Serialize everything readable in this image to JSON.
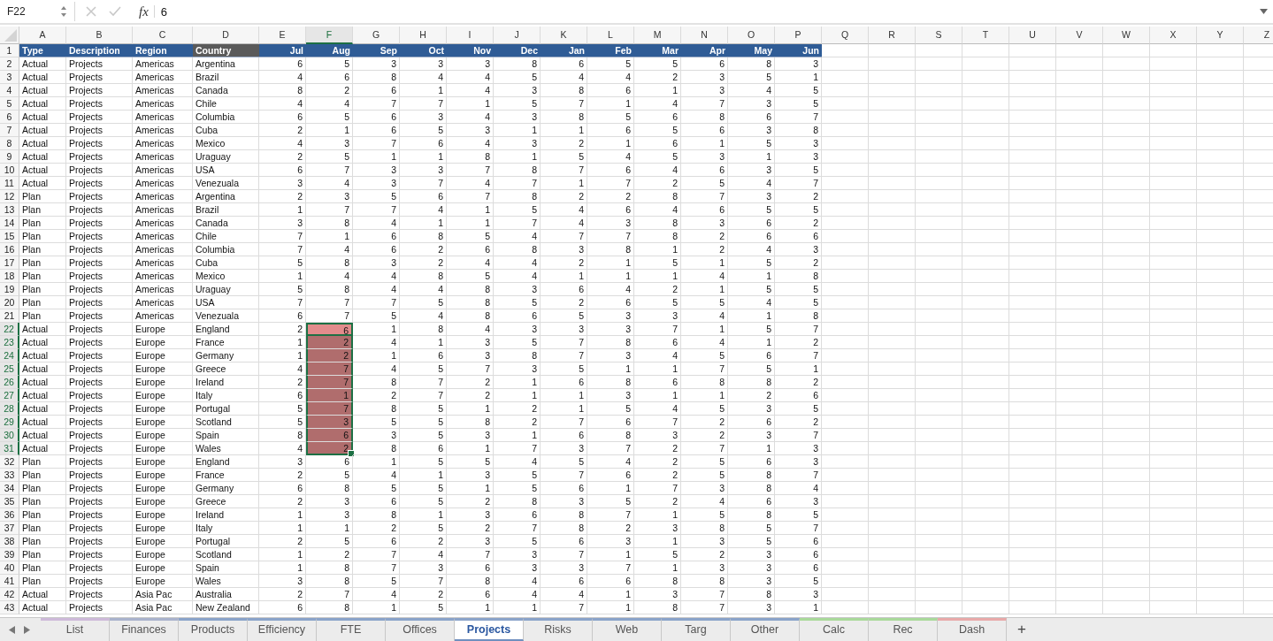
{
  "formula_bar": {
    "name_box": "F22",
    "function_label": "fx",
    "value": "6"
  },
  "columns": [
    {
      "letter": "A",
      "kind": "text",
      "selected": false
    },
    {
      "letter": "B",
      "kind": "text",
      "selected": false
    },
    {
      "letter": "C",
      "kind": "text",
      "selected": false
    },
    {
      "letter": "D",
      "kind": "text",
      "selected": false
    },
    {
      "letter": "E",
      "kind": "number",
      "selected": false
    },
    {
      "letter": "F",
      "kind": "number",
      "selected": true
    },
    {
      "letter": "G",
      "kind": "number",
      "selected": false
    },
    {
      "letter": "H",
      "kind": "number",
      "selected": false
    },
    {
      "letter": "I",
      "kind": "number",
      "selected": false
    },
    {
      "letter": "J",
      "kind": "number",
      "selected": false
    },
    {
      "letter": "K",
      "kind": "number",
      "selected": false
    },
    {
      "letter": "L",
      "kind": "number",
      "selected": false
    },
    {
      "letter": "M",
      "kind": "number",
      "selected": false
    },
    {
      "letter": "N",
      "kind": "number",
      "selected": false
    },
    {
      "letter": "O",
      "kind": "number",
      "selected": false
    },
    {
      "letter": "P",
      "kind": "number",
      "selected": false
    },
    {
      "letter": "Q",
      "selected": false
    },
    {
      "letter": "R",
      "selected": false
    },
    {
      "letter": "S",
      "selected": false
    },
    {
      "letter": "T",
      "selected": false
    },
    {
      "letter": "U",
      "selected": false
    },
    {
      "letter": "V",
      "selected": false
    },
    {
      "letter": "W",
      "selected": false
    },
    {
      "letter": "X",
      "selected": false
    },
    {
      "letter": "Y",
      "selected": false
    },
    {
      "letter": "Z",
      "selected": false
    }
  ],
  "header_row": {
    "number": "1",
    "cells": [
      {
        "text": "Type",
        "highlighted": false
      },
      {
        "text": "Description",
        "highlighted": false
      },
      {
        "text": "Region",
        "highlighted": false
      },
      {
        "text": "Country",
        "highlighted": true
      },
      {
        "text": "Jul",
        "highlighted": false
      },
      {
        "text": "Aug",
        "highlighted": false
      },
      {
        "text": "Sep",
        "highlighted": false
      },
      {
        "text": "Oct",
        "highlighted": false
      },
      {
        "text": "Nov",
        "highlighted": false
      },
      {
        "text": "Dec",
        "highlighted": false
      },
      {
        "text": "Jan",
        "highlighted": false
      },
      {
        "text": "Feb",
        "highlighted": false
      },
      {
        "text": "Mar",
        "highlighted": false
      },
      {
        "text": "Apr",
        "highlighted": false
      },
      {
        "text": "May",
        "highlighted": false
      },
      {
        "text": "Jun",
        "highlighted": false
      }
    ]
  },
  "rows": [
    {
      "number": "2",
      "selected": false,
      "active": false,
      "cells": [
        "Actual",
        "Projects",
        "Americas",
        "Argentina",
        "6",
        "5",
        "3",
        "3",
        "3",
        "8",
        "6",
        "5",
        "5",
        "6",
        "8",
        "3"
      ]
    },
    {
      "number": "3",
      "selected": false,
      "active": false,
      "cells": [
        "Actual",
        "Projects",
        "Americas",
        "Brazil",
        "4",
        "6",
        "8",
        "4",
        "4",
        "5",
        "4",
        "4",
        "2",
        "3",
        "5",
        "1"
      ]
    },
    {
      "number": "4",
      "selected": false,
      "active": false,
      "cells": [
        "Actual",
        "Projects",
        "Americas",
        "Canada",
        "8",
        "2",
        "6",
        "1",
        "4",
        "3",
        "8",
        "6",
        "1",
        "3",
        "4",
        "5"
      ]
    },
    {
      "number": "5",
      "selected": false,
      "active": false,
      "cells": [
        "Actual",
        "Projects",
        "Americas",
        "Chile",
        "4",
        "4",
        "7",
        "7",
        "1",
        "5",
        "7",
        "1",
        "4",
        "7",
        "3",
        "5"
      ]
    },
    {
      "number": "6",
      "selected": false,
      "active": false,
      "cells": [
        "Actual",
        "Projects",
        "Americas",
        "Columbia",
        "6",
        "5",
        "6",
        "3",
        "4",
        "3",
        "8",
        "5",
        "6",
        "8",
        "6",
        "7"
      ]
    },
    {
      "number": "7",
      "selected": false,
      "active": false,
      "cells": [
        "Actual",
        "Projects",
        "Americas",
        "Cuba",
        "2",
        "1",
        "6",
        "5",
        "3",
        "1",
        "1",
        "6",
        "5",
        "6",
        "3",
        "8"
      ]
    },
    {
      "number": "8",
      "selected": false,
      "active": false,
      "cells": [
        "Actual",
        "Projects",
        "Americas",
        "Mexico",
        "4",
        "3",
        "7",
        "6",
        "4",
        "3",
        "2",
        "1",
        "6",
        "1",
        "5",
        "3"
      ]
    },
    {
      "number": "9",
      "selected": false,
      "active": false,
      "cells": [
        "Actual",
        "Projects",
        "Americas",
        "Uraguay",
        "2",
        "5",
        "1",
        "1",
        "8",
        "1",
        "5",
        "4",
        "5",
        "3",
        "1",
        "3"
      ]
    },
    {
      "number": "10",
      "selected": false,
      "active": false,
      "cells": [
        "Actual",
        "Projects",
        "Americas",
        "USA",
        "6",
        "7",
        "3",
        "3",
        "7",
        "8",
        "7",
        "6",
        "4",
        "6",
        "3",
        "5"
      ]
    },
    {
      "number": "11",
      "selected": false,
      "active": false,
      "cells": [
        "Actual",
        "Projects",
        "Americas",
        "Venezuala",
        "3",
        "4",
        "3",
        "7",
        "4",
        "7",
        "1",
        "7",
        "2",
        "5",
        "4",
        "7"
      ]
    },
    {
      "number": "12",
      "selected": false,
      "active": false,
      "cells": [
        "Plan",
        "Projects",
        "Americas",
        "Argentina",
        "2",
        "3",
        "5",
        "6",
        "7",
        "8",
        "2",
        "2",
        "8",
        "7",
        "3",
        "2"
      ]
    },
    {
      "number": "13",
      "selected": false,
      "active": false,
      "cells": [
        "Plan",
        "Projects",
        "Americas",
        "Brazil",
        "1",
        "7",
        "7",
        "4",
        "1",
        "5",
        "4",
        "6",
        "4",
        "6",
        "5",
        "5"
      ]
    },
    {
      "number": "14",
      "selected": false,
      "active": false,
      "cells": [
        "Plan",
        "Projects",
        "Americas",
        "Canada",
        "3",
        "8",
        "4",
        "1",
        "1",
        "7",
        "4",
        "3",
        "8",
        "3",
        "6",
        "2"
      ]
    },
    {
      "number": "15",
      "selected": false,
      "active": false,
      "cells": [
        "Plan",
        "Projects",
        "Americas",
        "Chile",
        "7",
        "1",
        "6",
        "8",
        "5",
        "4",
        "7",
        "7",
        "8",
        "2",
        "6",
        "6"
      ]
    },
    {
      "number": "16",
      "selected": false,
      "active": false,
      "cells": [
        "Plan",
        "Projects",
        "Americas",
        "Columbia",
        "7",
        "4",
        "6",
        "2",
        "6",
        "8",
        "3",
        "8",
        "1",
        "2",
        "4",
        "3"
      ]
    },
    {
      "number": "17",
      "selected": false,
      "active": false,
      "cells": [
        "Plan",
        "Projects",
        "Americas",
        "Cuba",
        "5",
        "8",
        "3",
        "2",
        "4",
        "4",
        "2",
        "1",
        "5",
        "1",
        "5",
        "2"
      ]
    },
    {
      "number": "18",
      "selected": false,
      "active": false,
      "cells": [
        "Plan",
        "Projects",
        "Americas",
        "Mexico",
        "1",
        "4",
        "4",
        "8",
        "5",
        "4",
        "1",
        "1",
        "1",
        "4",
        "1",
        "8"
      ]
    },
    {
      "number": "19",
      "selected": false,
      "active": false,
      "cells": [
        "Plan",
        "Projects",
        "Americas",
        "Uraguay",
        "5",
        "8",
        "4",
        "4",
        "8",
        "3",
        "6",
        "4",
        "2",
        "1",
        "5",
        "5"
      ]
    },
    {
      "number": "20",
      "selected": false,
      "active": false,
      "cells": [
        "Plan",
        "Projects",
        "Americas",
        "USA",
        "7",
        "7",
        "7",
        "5",
        "8",
        "5",
        "2",
        "6",
        "5",
        "5",
        "4",
        "5"
      ]
    },
    {
      "number": "21",
      "selected": false,
      "active": false,
      "cells": [
        "Plan",
        "Projects",
        "Americas",
        "Venezuala",
        "6",
        "7",
        "5",
        "4",
        "8",
        "6",
        "5",
        "3",
        "3",
        "4",
        "1",
        "8"
      ]
    },
    {
      "number": "22",
      "selected": true,
      "active": true,
      "cells": [
        "Actual",
        "Projects",
        "Europe",
        "England",
        "2",
        "6",
        "1",
        "8",
        "4",
        "3",
        "3",
        "3",
        "7",
        "1",
        "5",
        "7"
      ]
    },
    {
      "number": "23",
      "selected": true,
      "active": false,
      "cells": [
        "Actual",
        "Projects",
        "Europe",
        "France",
        "1",
        "2",
        "4",
        "1",
        "3",
        "5",
        "7",
        "8",
        "6",
        "4",
        "1",
        "2"
      ]
    },
    {
      "number": "24",
      "selected": true,
      "active": false,
      "cells": [
        "Actual",
        "Projects",
        "Europe",
        "Germany",
        "1",
        "2",
        "1",
        "6",
        "3",
        "8",
        "7",
        "3",
        "4",
        "5",
        "6",
        "7"
      ]
    },
    {
      "number": "25",
      "selected": true,
      "active": false,
      "cells": [
        "Actual",
        "Projects",
        "Europe",
        "Greece",
        "4",
        "7",
        "4",
        "5",
        "7",
        "3",
        "5",
        "1",
        "1",
        "7",
        "5",
        "1"
      ]
    },
    {
      "number": "26",
      "selected": true,
      "active": false,
      "cells": [
        "Actual",
        "Projects",
        "Europe",
        "Ireland",
        "2",
        "7",
        "8",
        "7",
        "2",
        "1",
        "6",
        "8",
        "6",
        "8",
        "8",
        "2"
      ]
    },
    {
      "number": "27",
      "selected": true,
      "active": false,
      "cells": [
        "Actual",
        "Projects",
        "Europe",
        "Italy",
        "6",
        "1",
        "2",
        "7",
        "2",
        "1",
        "1",
        "3",
        "1",
        "1",
        "2",
        "6"
      ]
    },
    {
      "number": "28",
      "selected": true,
      "active": false,
      "cells": [
        "Actual",
        "Projects",
        "Europe",
        "Portugal",
        "5",
        "7",
        "8",
        "5",
        "1",
        "2",
        "1",
        "5",
        "4",
        "5",
        "3",
        "5"
      ]
    },
    {
      "number": "29",
      "selected": true,
      "active": false,
      "cells": [
        "Actual",
        "Projects",
        "Europe",
        "Scotland",
        "5",
        "3",
        "5",
        "5",
        "8",
        "2",
        "7",
        "6",
        "7",
        "2",
        "6",
        "2"
      ]
    },
    {
      "number": "30",
      "selected": true,
      "active": false,
      "cells": [
        "Actual",
        "Projects",
        "Europe",
        "Spain",
        "8",
        "6",
        "3",
        "5",
        "3",
        "1",
        "6",
        "8",
        "3",
        "2",
        "3",
        "7"
      ]
    },
    {
      "number": "31",
      "selected": true,
      "active": false,
      "cells": [
        "Actual",
        "Projects",
        "Europe",
        "Wales",
        "4",
        "2",
        "8",
        "6",
        "1",
        "7",
        "3",
        "7",
        "2",
        "7",
        "1",
        "3"
      ]
    },
    {
      "number": "32",
      "selected": false,
      "active": false,
      "cells": [
        "Plan",
        "Projects",
        "Europe",
        "England",
        "3",
        "6",
        "1",
        "5",
        "5",
        "4",
        "5",
        "4",
        "2",
        "5",
        "6",
        "3"
      ]
    },
    {
      "number": "33",
      "selected": false,
      "active": false,
      "cells": [
        "Plan",
        "Projects",
        "Europe",
        "France",
        "2",
        "5",
        "4",
        "1",
        "3",
        "5",
        "7",
        "6",
        "2",
        "5",
        "8",
        "7"
      ]
    },
    {
      "number": "34",
      "selected": false,
      "active": false,
      "cells": [
        "Plan",
        "Projects",
        "Europe",
        "Germany",
        "6",
        "8",
        "5",
        "5",
        "1",
        "5",
        "6",
        "1",
        "7",
        "3",
        "8",
        "4"
      ]
    },
    {
      "number": "35",
      "selected": false,
      "active": false,
      "cells": [
        "Plan",
        "Projects",
        "Europe",
        "Greece",
        "2",
        "3",
        "6",
        "5",
        "2",
        "8",
        "3",
        "5",
        "2",
        "4",
        "6",
        "3"
      ]
    },
    {
      "number": "36",
      "selected": false,
      "active": false,
      "cells": [
        "Plan",
        "Projects",
        "Europe",
        "Ireland",
        "1",
        "3",
        "8",
        "1",
        "3",
        "6",
        "8",
        "7",
        "1",
        "5",
        "8",
        "5"
      ]
    },
    {
      "number": "37",
      "selected": false,
      "active": false,
      "cells": [
        "Plan",
        "Projects",
        "Europe",
        "Italy",
        "1",
        "1",
        "2",
        "5",
        "2",
        "7",
        "8",
        "2",
        "3",
        "8",
        "5",
        "7"
      ]
    },
    {
      "number": "38",
      "selected": false,
      "active": false,
      "cells": [
        "Plan",
        "Projects",
        "Europe",
        "Portugal",
        "2",
        "5",
        "6",
        "2",
        "3",
        "5",
        "6",
        "3",
        "1",
        "3",
        "5",
        "6"
      ]
    },
    {
      "number": "39",
      "selected": false,
      "active": false,
      "cells": [
        "Plan",
        "Projects",
        "Europe",
        "Scotland",
        "1",
        "2",
        "7",
        "4",
        "7",
        "3",
        "7",
        "1",
        "5",
        "2",
        "3",
        "6"
      ]
    },
    {
      "number": "40",
      "selected": false,
      "active": false,
      "cells": [
        "Plan",
        "Projects",
        "Europe",
        "Spain",
        "1",
        "8",
        "7",
        "3",
        "6",
        "3",
        "3",
        "7",
        "1",
        "3",
        "3",
        "6"
      ]
    },
    {
      "number": "41",
      "selected": false,
      "active": false,
      "cells": [
        "Plan",
        "Projects",
        "Europe",
        "Wales",
        "3",
        "8",
        "5",
        "7",
        "8",
        "4",
        "6",
        "6",
        "8",
        "8",
        "3",
        "5"
      ]
    },
    {
      "number": "42",
      "selected": false,
      "active": false,
      "cells": [
        "Actual",
        "Projects",
        "Asia Pac",
        "Australia",
        "2",
        "7",
        "4",
        "2",
        "6",
        "4",
        "4",
        "1",
        "3",
        "7",
        "8",
        "3"
      ]
    },
    {
      "number": "43",
      "selected": false,
      "active": false,
      "cells": [
        "Actual",
        "Projects",
        "Asia Pac",
        "New Zealand",
        "6",
        "8",
        "1",
        "5",
        "1",
        "1",
        "7",
        "1",
        "8",
        "7",
        "3",
        "1"
      ]
    }
  ],
  "sheet_tabs": [
    {
      "label": "List",
      "selected": false,
      "color": "#cdb9d9"
    },
    {
      "label": "Finances",
      "selected": false,
      "color": "#a9b2cc"
    },
    {
      "label": "Products",
      "selected": false,
      "color": "#8aa3c9"
    },
    {
      "label": "Efficiency",
      "selected": false,
      "color": "#8aa3c9"
    },
    {
      "label": "FTE",
      "selected": false,
      "color": "#8aa3c9"
    },
    {
      "label": "Offices",
      "selected": false,
      "color": "#8aa3c9"
    },
    {
      "label": "Projects",
      "selected": true,
      "color": "#8aa3c9"
    },
    {
      "label": "Risks",
      "selected": false,
      "color": "#8aa3c9"
    },
    {
      "label": "Web",
      "selected": false,
      "color": "#8aa3c9"
    },
    {
      "label": "Targ",
      "selected": false,
      "color": "#8aa3c9"
    },
    {
      "label": "Other",
      "selected": false,
      "color": "#8aa3c9"
    },
    {
      "label": "Calc",
      "selected": false,
      "color": "#a9d99a"
    },
    {
      "label": "Rec",
      "selected": false,
      "color": "#a9d99a"
    },
    {
      "label": "Dash",
      "selected": false,
      "color": "#e8a9a9"
    }
  ],
  "add_sheet": "+"
}
